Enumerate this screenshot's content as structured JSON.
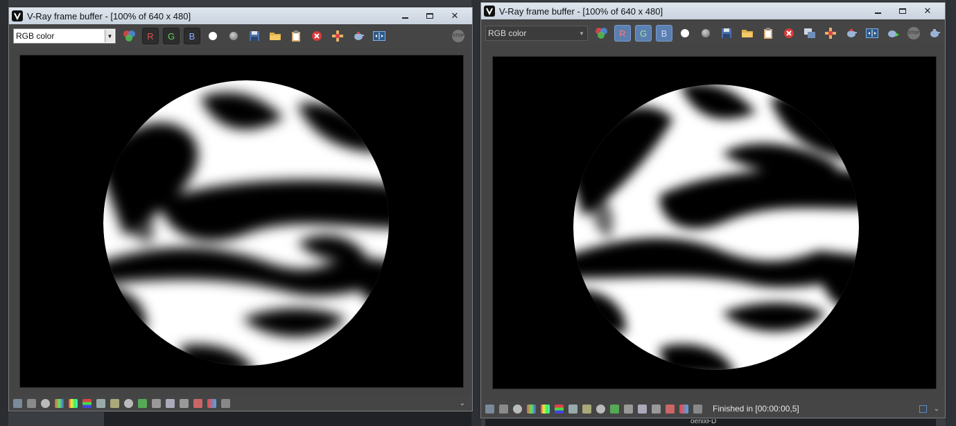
{
  "left_window": {
    "title": "V-Ray frame buffer - [100% of 640 x 480]",
    "channel_select": "RGB color",
    "channels": [
      "R",
      "G",
      "B"
    ]
  },
  "right_window": {
    "title": "V-Ray frame buffer - [100% of 640 x 480]",
    "channel_select": "RGB color",
    "channels": [
      "R",
      "G",
      "B"
    ],
    "status": "Finished in [00:00:00,5]"
  },
  "background": {
    "partial_label": "oenixFD"
  },
  "icons": {
    "window_minimize": "minimize-icon",
    "window_maximize": "maximize-icon",
    "window_close": "close-icon",
    "stop": "stop-icon"
  },
  "colors": {
    "titlebar": "#d5dde7",
    "toolbar": "#454545",
    "channel_on": "#5b7fb0",
    "render_bg": "#000000",
    "sphere": "#ffffff"
  }
}
